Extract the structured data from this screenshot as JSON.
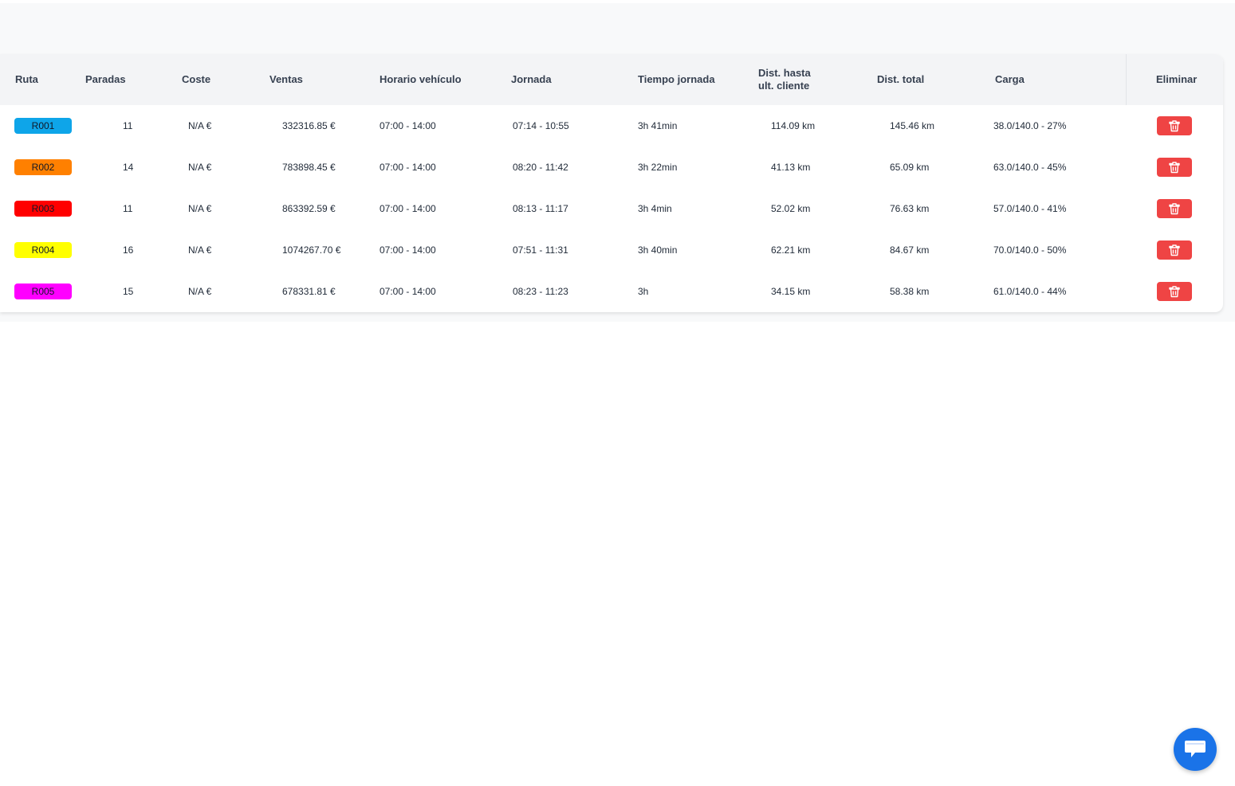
{
  "table": {
    "headers": {
      "ruta": "Ruta",
      "paradas": "Paradas",
      "coste": "Coste",
      "ventas": "Ventas",
      "horario": "Horario vehículo",
      "jornada": "Jornada",
      "tiempo": "Tiempo jornada",
      "dist_hasta_1": "Dist. hasta",
      "dist_hasta_2": "ult. cliente",
      "dist_total": "Dist. total",
      "carga": "Carga",
      "eliminar": "Eliminar"
    },
    "rows": [
      {
        "ruta": "R001",
        "color": "#0ea5e9",
        "paradas": "11",
        "coste": "N/A €",
        "ventas": "332316.85 €",
        "horario": "07:00 - 14:00",
        "jornada": "07:14 - 10:55",
        "tiempo": "3h 41min",
        "dist_hasta": "114.09 km",
        "dist_total": "145.46 km",
        "carga": "38.0/140.0 - 27%"
      },
      {
        "ruta": "R002",
        "color": "#ff8000",
        "paradas": "14",
        "coste": "N/A €",
        "ventas": "783898.45 €",
        "horario": "07:00 - 14:00",
        "jornada": "08:20 - 11:42",
        "tiempo": "3h 22min",
        "dist_hasta": "41.13 km",
        "dist_total": "65.09 km",
        "carga": "63.0/140.0 - 45%"
      },
      {
        "ruta": "R003",
        "color": "#ff0000",
        "paradas": "11",
        "coste": "N/A €",
        "ventas": "863392.59 €",
        "horario": "07:00 - 14:00",
        "jornada": "08:13 - 11:17",
        "tiempo": "3h 4min",
        "dist_hasta": "52.02 km",
        "dist_total": "76.63 km",
        "carga": "57.0/140.0 - 41%"
      },
      {
        "ruta": "R004",
        "color": "#ffff00",
        "paradas": "16",
        "coste": "N/A €",
        "ventas": "1074267.70 €",
        "horario": "07:00 - 14:00",
        "jornada": "07:51 - 11:31",
        "tiempo": "3h 40min",
        "dist_hasta": "62.21 km",
        "dist_total": "84.67 km",
        "carga": "70.0/140.0 - 50%"
      },
      {
        "ruta": "R005",
        "color": "#ff00ff",
        "paradas": "15",
        "coste": "N/A €",
        "ventas": "678331.81 €",
        "horario": "07:00 - 14:00",
        "jornada": "08:23 - 11:23",
        "tiempo": "3h",
        "dist_hasta": "34.15 km",
        "dist_total": "58.38 km",
        "carga": "61.0/140.0 - 44%"
      }
    ]
  },
  "icons": {
    "delete": "trash-icon",
    "chat": "chat-icon"
  },
  "colors": {
    "delete_button": "#ef4444",
    "chat_button": "#1a73e8"
  }
}
